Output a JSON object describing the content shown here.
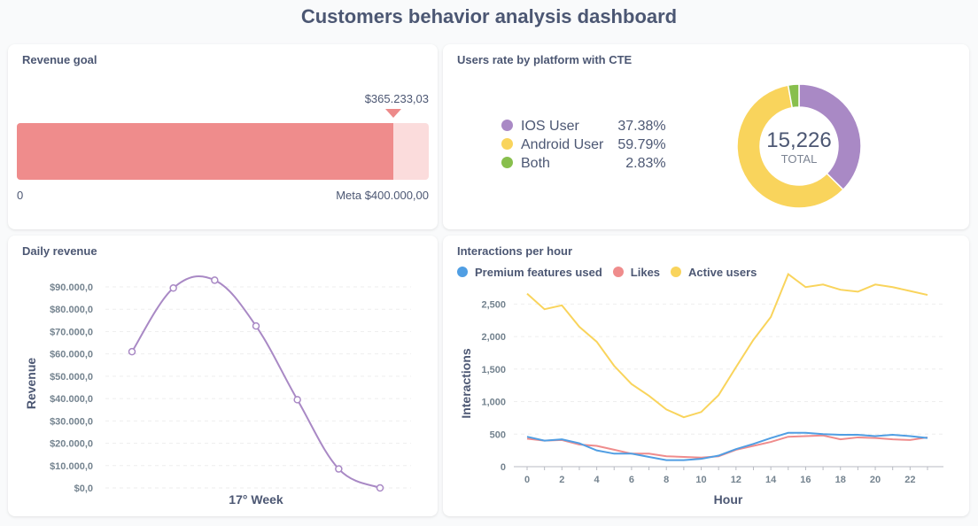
{
  "dashboard": {
    "title": "Customers behavior analysis dashboard"
  },
  "revenue_goal": {
    "title": "Revenue goal",
    "current_label": "$365.233,03",
    "current_value": 365233.03,
    "goal_value": 400000.0,
    "start_label": "0",
    "goal_label": "Meta $400.000,00",
    "colors": {
      "fill": "#ef8c8c",
      "track": "#fbdcdc"
    }
  },
  "platform": {
    "title": "Users rate by platform with CTE",
    "total_value": "15,226",
    "total_label": "TOTAL",
    "items": [
      {
        "name": "IOS User",
        "pct_label": "37.38%",
        "pct": 37.38,
        "color": "#a989c5"
      },
      {
        "name": "Android User",
        "pct_label": "59.79%",
        "pct": 59.79,
        "color": "#f9d45c"
      },
      {
        "name": "Both",
        "pct_label": "2.83%",
        "pct": 2.83,
        "color": "#88bf4d"
      }
    ]
  },
  "daily": {
    "title": "Daily revenue"
  },
  "hourly": {
    "title": "Interactions per hour",
    "legend": [
      {
        "name": "Premium features used",
        "color": "#509ee3"
      },
      {
        "name": "Likes",
        "color": "#ef8c8c"
      },
      {
        "name": "Active users",
        "color": "#f9d45c"
      }
    ]
  },
  "chart_data": [
    {
      "type": "pie",
      "title": "Users rate by platform with CTE",
      "categories": [
        "IOS User",
        "Android User",
        "Both"
      ],
      "values": [
        37.38,
        59.79,
        2.83
      ],
      "total": 15226
    },
    {
      "type": "line",
      "title": "Daily revenue",
      "xlabel": "17° Week",
      "ylabel": "Revenue",
      "x": [
        1,
        2,
        3,
        4,
        5,
        6,
        7
      ],
      "values": [
        61000,
        89500,
        93000,
        72500,
        39500,
        8500,
        0
      ],
      "yticks": [
        0,
        10000,
        20000,
        30000,
        40000,
        50000,
        60000,
        70000,
        80000,
        90000
      ],
      "ytick_labels": [
        "$0,0",
        "$10.000,0",
        "$20.000,0",
        "$30.000,0",
        "$40.000,0",
        "$50.000,0",
        "$60.000,0",
        "$70.000,0",
        "$80.000,0",
        "$90.000,0"
      ],
      "ylim": [
        0,
        90000
      ],
      "color": "#a989c5",
      "grid": true
    },
    {
      "type": "line",
      "title": "Interactions per hour",
      "xlabel": "Hour",
      "ylabel": "Interactions",
      "x": [
        0,
        1,
        2,
        3,
        4,
        5,
        6,
        7,
        8,
        9,
        10,
        11,
        12,
        13,
        14,
        15,
        16,
        17,
        18,
        19,
        20,
        21,
        22,
        23
      ],
      "xticks": [
        0,
        2,
        4,
        6,
        8,
        10,
        12,
        14,
        16,
        18,
        20,
        22
      ],
      "yticks": [
        0,
        500,
        1000,
        1500,
        2000,
        2500
      ],
      "ytick_labels": [
        "0",
        "500",
        "1,000",
        "1,500",
        "2,000",
        "2,500"
      ],
      "ylim": [
        0,
        2600
      ],
      "grid": true,
      "series": [
        {
          "name": "Premium features used",
          "color": "#509ee3",
          "values": [
            460,
            400,
            420,
            360,
            250,
            200,
            200,
            150,
            100,
            100,
            120,
            170,
            270,
            350,
            440,
            520,
            520,
            500,
            490,
            490,
            470,
            490,
            470,
            440
          ]
        },
        {
          "name": "Likes",
          "color": "#ef8c8c",
          "values": [
            430,
            400,
            410,
            340,
            320,
            260,
            200,
            200,
            160,
            150,
            140,
            160,
            260,
            320,
            380,
            460,
            470,
            480,
            420,
            450,
            440,
            420,
            410,
            450
          ]
        },
        {
          "name": "Active users",
          "color": "#f9d45c",
          "values": [
            2660,
            2420,
            2480,
            2150,
            1920,
            1550,
            1270,
            1090,
            880,
            760,
            840,
            1100,
            1530,
            1950,
            2300,
            2960,
            2760,
            2800,
            2720,
            2690,
            2800,
            2760,
            2700,
            2640
          ]
        }
      ]
    }
  ]
}
